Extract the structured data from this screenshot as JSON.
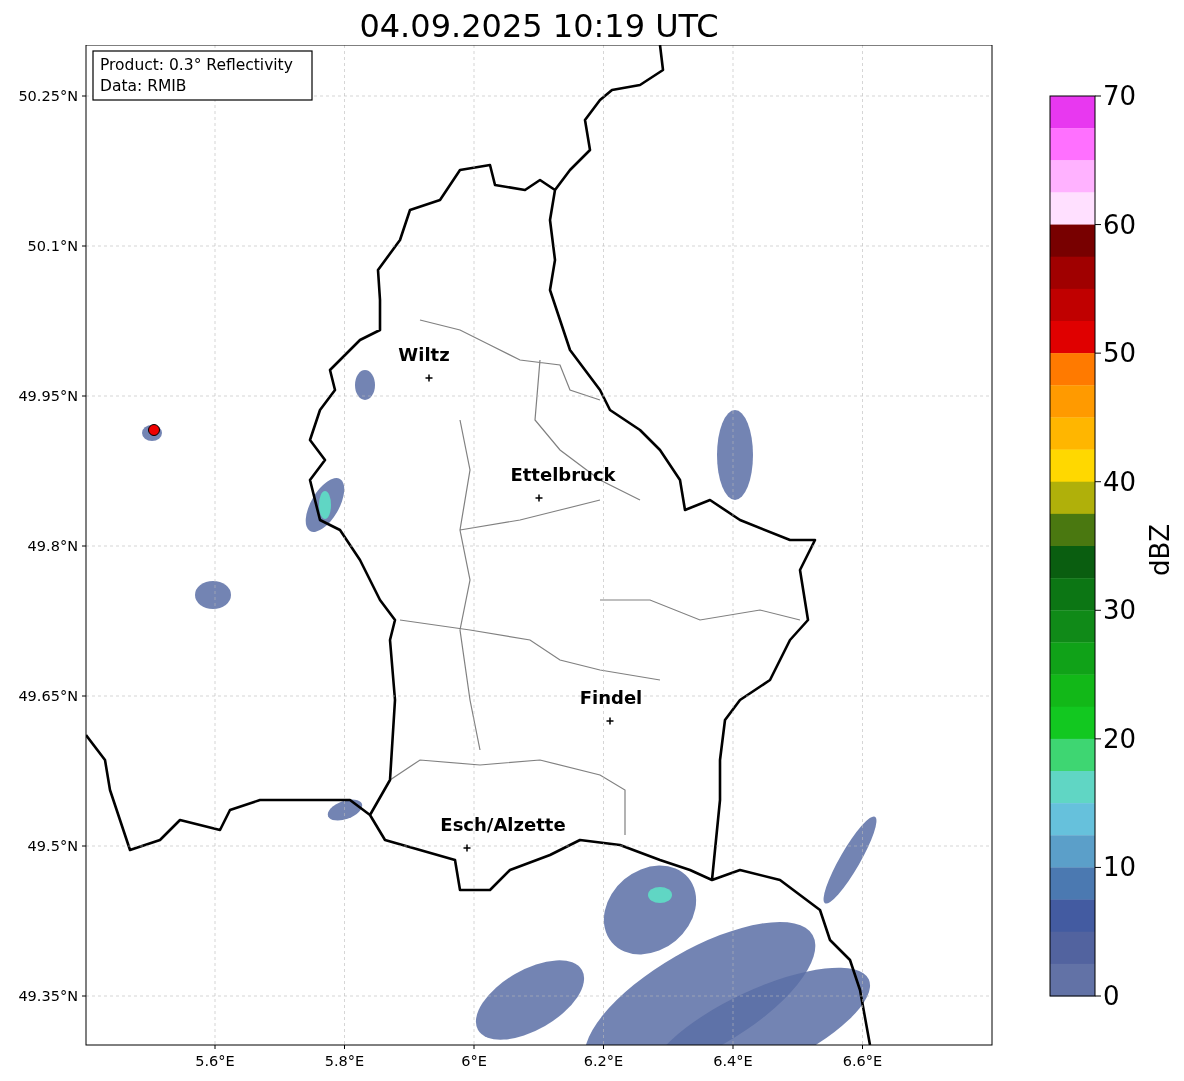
{
  "title": "04.09.2025 10:19 UTC",
  "info_box": [
    "Product: 0.3° Reflectivity",
    "Data: RMIB"
  ],
  "map": {
    "yticks": [
      "50.25°N",
      "50.1°N",
      "49.95°N",
      "49.8°N",
      "49.65°N",
      "49.5°N",
      "49.35°N"
    ],
    "xticks": [
      "5.6°E",
      "5.8°E",
      "6°E",
      "6.2°E",
      "6.4°E",
      "6.6°E"
    ],
    "cities": [
      {
        "name": "Wiltz"
      },
      {
        "name": "Ettelbruck"
      },
      {
        "name": "Findel"
      },
      {
        "name": "Esch/Alzette"
      }
    ]
  },
  "colorbar": {
    "label": "dBZ",
    "ticks": [
      "70",
      "60",
      "50",
      "40",
      "30",
      "20",
      "10",
      "0"
    ],
    "bands": [
      {
        "color": "#e838f0"
      },
      {
        "color": "#ff70ff"
      },
      {
        "color": "#ffb2ff"
      },
      {
        "color": "#ffe0ff"
      },
      {
        "color": "#780000"
      },
      {
        "color": "#a00000"
      },
      {
        "color": "#c00000"
      },
      {
        "color": "#e00000"
      },
      {
        "color": "#ff7a00"
      },
      {
        "color": "#ff9a00"
      },
      {
        "color": "#ffb600"
      },
      {
        "color": "#ffd800"
      },
      {
        "color": "#b0b00a"
      },
      {
        "color": "#4a7810"
      },
      {
        "color": "#0a5e10"
      },
      {
        "color": "#0c7614"
      },
      {
        "color": "#108a18"
      },
      {
        "color": "#10a218"
      },
      {
        "color": "#12b818"
      },
      {
        "color": "#12c820"
      },
      {
        "color": "#3ed672"
      },
      {
        "color": "#60d6c4"
      },
      {
        "color": "#66c1dc"
      },
      {
        "color": "#5b9fc9"
      },
      {
        "color": "#4b79b1"
      },
      {
        "color": "#435ba1"
      },
      {
        "color": "#52639f"
      },
      {
        "color": "#6272a6"
      }
    ]
  }
}
